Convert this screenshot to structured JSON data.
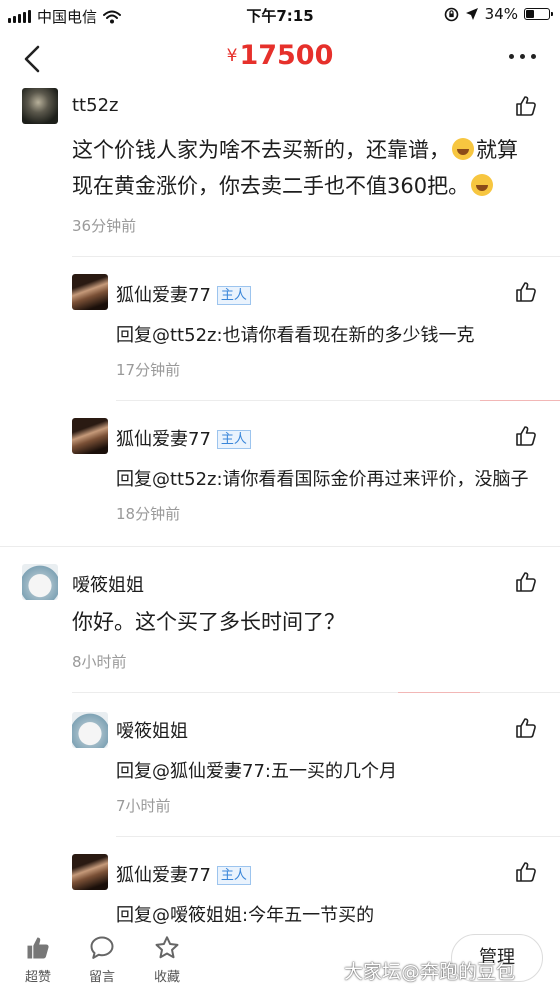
{
  "status_bar": {
    "carrier": "中国电信",
    "time": "下午7:15",
    "battery": "34%"
  },
  "header": {
    "currency": "¥",
    "price": "17500"
  },
  "comments": [
    {
      "name": "tt52z",
      "text_line1_a": "这个价钱人家为啥不去买新的，还靠谱，",
      "text_line1_b": "就算",
      "text_line2": "现在黄金涨价，你去卖二手也不值360把。",
      "time": "36分钟前",
      "replies": [
        {
          "name": "狐仙爱妻77",
          "tag": "主人",
          "text": "回复@tt52z:也请你看看现在新的多少钱一克",
          "time": "17分钟前"
        },
        {
          "name": "狐仙爱妻77",
          "tag": "主人",
          "text": "回复@tt52z:请你看看国际金价再过来评价，没脑子",
          "time": "18分钟前"
        }
      ]
    },
    {
      "name": "嗳筱姐姐",
      "text": "你好。这个买了多长时间了？",
      "time": "8小时前",
      "replies": [
        {
          "name": "嗳筱姐姐",
          "text": "回复@狐仙爱妻77:五一买的几个月",
          "time": "7小时前"
        },
        {
          "name": "狐仙爱妻77",
          "tag": "主人",
          "text": "回复@嗳筱姐姐:今年五一节买的"
        }
      ]
    }
  ],
  "bottom_bar": {
    "like_label": "超赞",
    "comment_label": "留言",
    "favorite_label": "收藏",
    "manage_label": "管理"
  },
  "watermark": "大家坛@奔跑的豆包",
  "colors": {
    "accent": "#e6302b",
    "host_tag": "#3a86d9",
    "time_text": "#9a9a9a"
  }
}
